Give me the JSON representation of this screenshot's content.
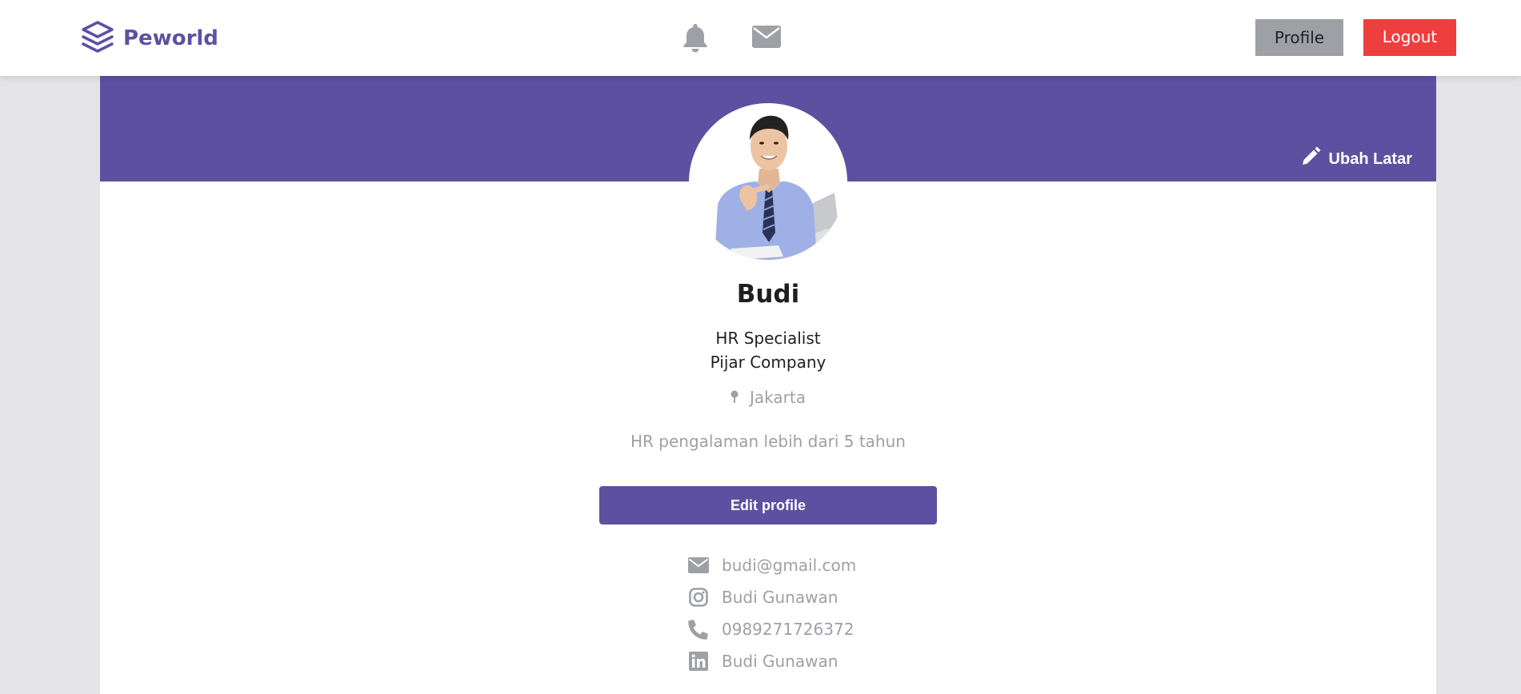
{
  "navbar": {
    "brand": "Peworld",
    "profile_label": "Profile",
    "logout_label": "Logout"
  },
  "banner": {
    "change_background_label": "Ubah Latar"
  },
  "profile": {
    "name": "Budi",
    "job": "HR Specialist",
    "company": "Pijar Company",
    "location": "Jakarta",
    "bio": "HR pengalaman lebih dari 5 tahun",
    "edit_label": "Edit profile"
  },
  "contacts": [
    {
      "icon": "mail-icon",
      "value": "budi@gmail.com"
    },
    {
      "icon": "instagram-icon",
      "value": "Budi Gunawan"
    },
    {
      "icon": "phone-icon",
      "value": "0989271726372"
    },
    {
      "icon": "linkedin-icon",
      "value": "Budi Gunawan"
    }
  ],
  "colors": {
    "brand": "#5e50a1",
    "logout": "#ef3e3e",
    "profile_button": "#9ea0a5",
    "muted_text": "#9ea0a5"
  }
}
